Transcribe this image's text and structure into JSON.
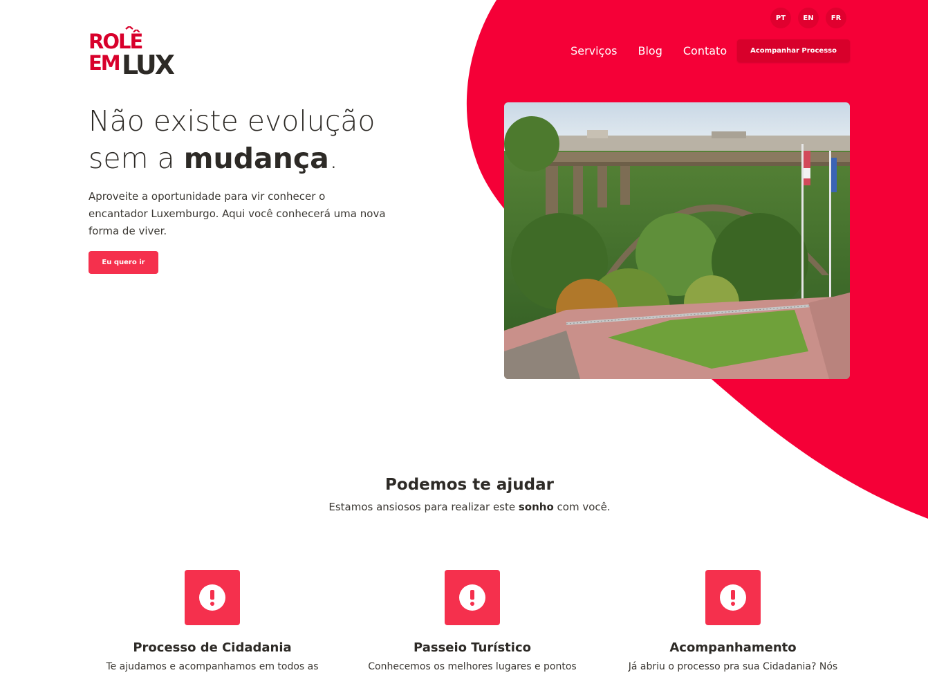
{
  "brand": {
    "logo_line1": "ROLÊ",
    "logo_line2a": "EM",
    "logo_line2b": "LUX",
    "accent": "#f50037",
    "dark": "#2d2a26"
  },
  "languages": [
    "PT",
    "EN",
    "FR"
  ],
  "nav": {
    "items": [
      "Serviços",
      "Blog",
      "Contato"
    ],
    "cta": "Acompanhar Processo"
  },
  "hero": {
    "title_line1": "Não existe evolução",
    "title_line2_prefix": "sem a ",
    "title_line2_bold": "mudança",
    "title_line2_suffix": ".",
    "text": "Aproveite a oportunidade para vir conhecer o encantador Luxemburgo. Aqui você conhecerá uma nova forma de viver.",
    "button": "Eu quero ir"
  },
  "help": {
    "title": "Podemos te ajudar",
    "subtitle_prefix": "Estamos ansiosos para realizar este ",
    "subtitle_bold": "sonho",
    "subtitle_suffix": " com você."
  },
  "cards": [
    {
      "title": "Processo de Cidadania",
      "text": "Te ajudamos e acompanhamos em todos as"
    },
    {
      "title": "Passeio Turístico",
      "text": "Conhecemos os melhores lugares e pontos"
    },
    {
      "title": "Acompanhamento",
      "text": "Já abriu o processo pra sua Cidadania? Nós"
    }
  ]
}
